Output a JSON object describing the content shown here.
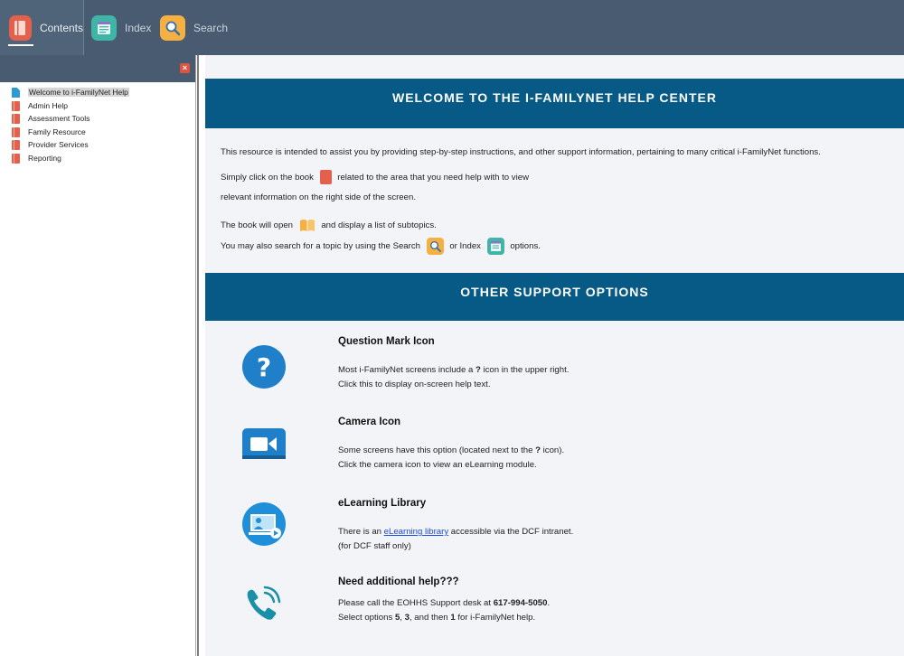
{
  "toolbar": {
    "tabs": [
      {
        "label": "Contents",
        "icon": "book-icon",
        "color": "#e2604c"
      },
      {
        "label": "Index",
        "icon": "index-icon",
        "color": "#3fb5a8"
      },
      {
        "label": "Search",
        "icon": "search-icon",
        "color": "#f5b041"
      }
    ]
  },
  "sidebar": {
    "close_icon": "close-icon",
    "items": [
      {
        "label": "Welcome to i-FamilyNet Help",
        "icon": "page-icon",
        "selected": true
      },
      {
        "label": "Admin Help",
        "icon": "book-icon"
      },
      {
        "label": "Assessment Tools",
        "icon": "book-icon"
      },
      {
        "label": "Family Resource",
        "icon": "book-icon"
      },
      {
        "label": "Provider Services",
        "icon": "book-icon"
      },
      {
        "label": "Reporting",
        "icon": "book-icon"
      }
    ]
  },
  "main": {
    "welcome_title": "WELCOME TO THE I-FAMILYNET HELP CENTER",
    "intro": "This resource is intended to assist you by providing step-by-step instructions, and other support information, pertaining to many critical i-FamilyNet functions.",
    "book_line_a": "Simply click on the book",
    "book_line_b": "related to the area that you need help with to view",
    "book_line_c": "relevant information on the right side of the screen.",
    "open_line_a": "The book will open",
    "open_line_b": "and display a list of subtopics.",
    "search_line_a": "You may also search for a topic by using the Search",
    "search_line_b": "or Index",
    "search_line_c": "options.",
    "other_title": "OTHER SUPPORT OPTIONS",
    "options": [
      {
        "title": "Question Mark Icon",
        "icon": "question-mark-icon",
        "line1_a": "Most i-FamilyNet screens include a ",
        "line1_b": "?",
        "line1_c": " icon in the upper right.",
        "line2": "Click this to display on-screen help text."
      },
      {
        "title": "Camera Icon",
        "icon": "camera-icon",
        "line1_a": "Some screens have this option (located next to the ",
        "line1_b": "?",
        "line1_c": " icon).",
        "line2": "Click the camera icon to view an eLearning module."
      },
      {
        "title": "eLearning Library",
        "icon": "elearning-icon",
        "line1_a": "There is an ",
        "line1_link": "eLearning library",
        "line1_c": " accessible via the DCF intranet.",
        "line2": "(for DCF staff only)"
      },
      {
        "title": "Need additional help???",
        "icon": "phone-icon",
        "line1_a": "Please call the EOHHS Support desk at ",
        "line1_b": "617-994-5050",
        "line1_c": ".",
        "line2_a": "Select options ",
        "line2_b": "5",
        "line2_c": ", ",
        "line2_d": "3",
        "line2_e": ", and then ",
        "line2_f": "1",
        "line2_g": " for i-FamilyNet help."
      }
    ]
  },
  "colors": {
    "toolbar": "#485b70",
    "band": "#065a85",
    "content_bg": "#f3f4f8",
    "option_icon": "#1f7fc9"
  }
}
